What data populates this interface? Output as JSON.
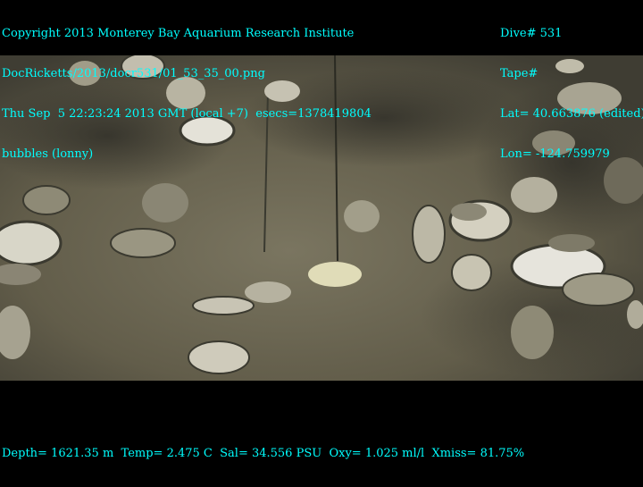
{
  "overlay": {
    "top_left": [
      "Copyright 2013 Monterey Bay Aquarium Research Institute",
      "DocRicketts/2013/docr531/01_53_35_00.png",
      "Thu Sep  5 22:23:24 2013 GMT (local +7)  esecs=1378419804",
      "bubbles (lonny)"
    ],
    "top_right": [
      "Dive# 531",
      "Tape#",
      "Lat= 40.663876 (edited)",
      "Lon= -124.759979"
    ],
    "bottom": "Depth= 1621.35 m  Temp= 2.475 C  Sal= 34.556 PSU  Oxy= 1.025 ml/l  Xmiss= 81.75%"
  },
  "colors": {
    "overlay_text": "#00ffff",
    "seafloor": "#6b6650",
    "shell": "#d8d6c8"
  }
}
